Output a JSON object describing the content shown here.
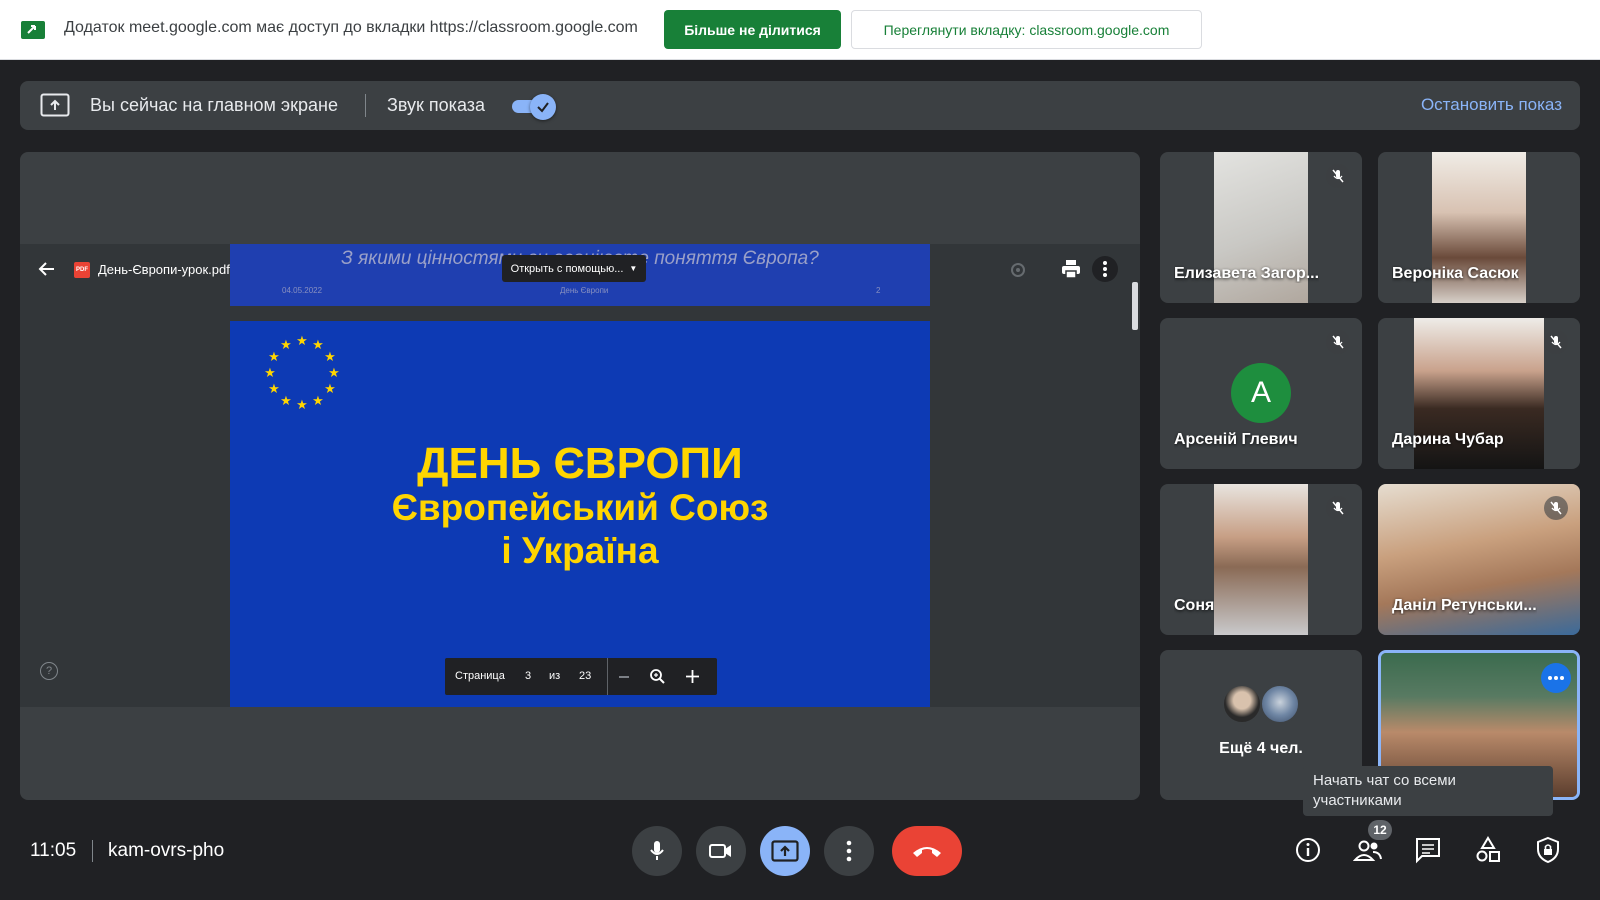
{
  "share_banner": {
    "text": "Додаток meet.google.com має доступ до вкладки https://classroom.google.com",
    "stop_sharing_label": "Більше не ділитися",
    "view_tab_label": "Переглянути вкладку: classroom.google.com"
  },
  "present_bar": {
    "status_text": "Вы сейчас на главном экране",
    "sound_label": "Звук показа",
    "sound_enabled": true,
    "stop_label": "Остановить показ"
  },
  "pdf_viewer": {
    "filename": "День-Європи-урок.pdf",
    "open_with_label": "Открыть с помощью...",
    "page_label": "Страница",
    "page_current": "3",
    "page_of_label": "из",
    "page_total": "23"
  },
  "slide_prev": {
    "question": "З якими цінностями ви асоціюєте поняття Європа?",
    "date": "04.05.2022",
    "footer_title": "День Європи",
    "page_num": "2"
  },
  "slide": {
    "title": "ДЕНЬ ЄВРОПИ",
    "subtitle_line1": "Європейський Союз",
    "subtitle_line2": "і Україна",
    "star_color": "#ffd500",
    "bg_color": "#0d3ab4"
  },
  "participants": [
    {
      "name": "Елизавета Загор...",
      "muted": true
    },
    {
      "name": "Вероніка Сасюк",
      "muted": false
    },
    {
      "name": "Арсеній Глевич",
      "muted": true,
      "avatar_letter": "А"
    },
    {
      "name": "Дарина Чубар",
      "muted": true
    },
    {
      "name": "Соня",
      "muted": true
    },
    {
      "name": "Даніл Ретунськи...",
      "muted": true
    }
  ],
  "more_participants": {
    "label": "Ещё 4 чел."
  },
  "tooltip": {
    "text": "Начать чат со всеми участниками"
  },
  "bottom_bar": {
    "time": "11:05",
    "meeting_code": "kam-ovrs-pho",
    "people_count": "12"
  },
  "colors": {
    "accent": "#8ab4f8",
    "green": "#188038",
    "leave": "#ea4335",
    "bg": "#202124",
    "surface": "#3c4043"
  },
  "icons": [
    "cast-icon",
    "present-screen-icon",
    "arrow-back-icon",
    "print-icon",
    "more-vert-icon",
    "mic-off-icon",
    "mic-icon",
    "camera-icon",
    "present-icon",
    "call-end-icon",
    "info-icon",
    "people-icon",
    "chat-icon",
    "activities-icon",
    "host-controls-icon",
    "help-icon",
    "zoom-in-icon",
    "plus-icon",
    "minus-icon"
  ]
}
